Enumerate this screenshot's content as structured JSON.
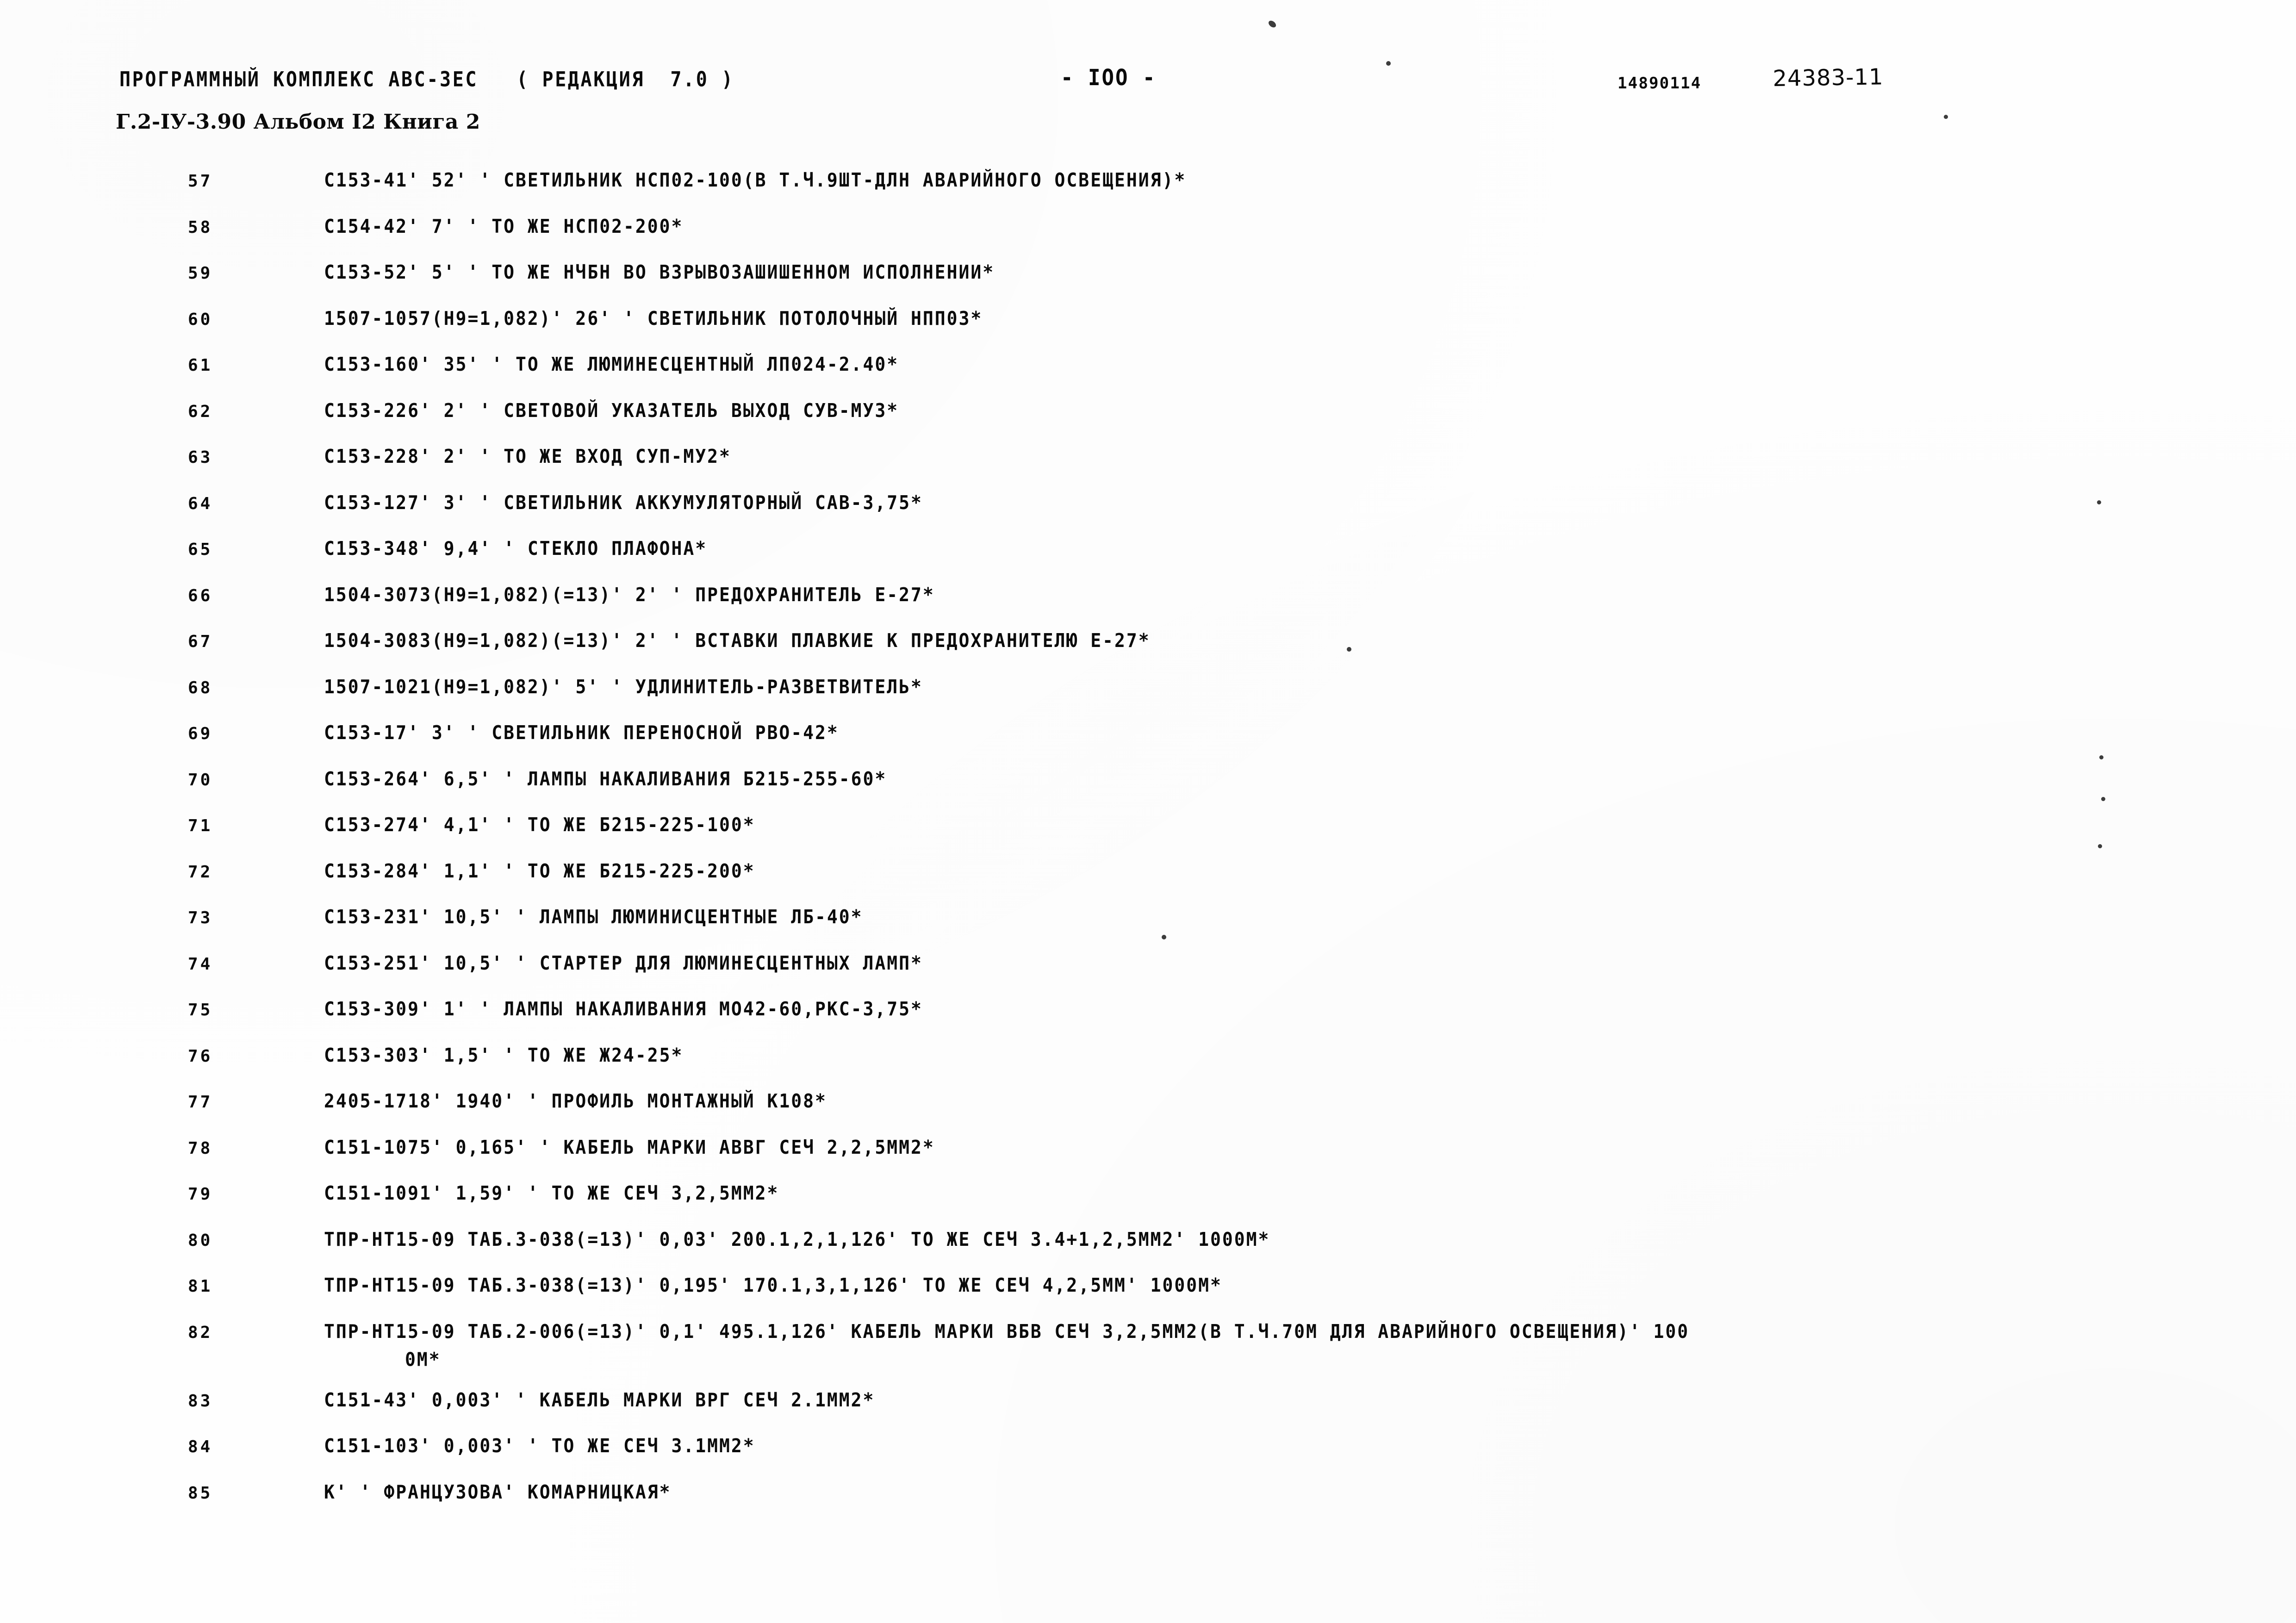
{
  "header": {
    "program_complex": "ПРОГРАММНЫЙ КОМПЛЕКС АВС-3ЕС   ( РЕДАКЦИЯ  7.0 )",
    "page_number": "- IOO -",
    "doc_code": "14890114",
    "stamp_number": "24383-11",
    "album_line": "Г.2-IУ-3.90 Альбом I2 Книга 2"
  },
  "listing": {
    "rows": [
      {
        "num": "57",
        "text": "C153-41' 52' ' СВЕТИЛЬНИК НСП02-100(В Т.Ч.9ШТ-ДЛН АВАРИЙНОГО ОСВЕЩЕНИЯ)*"
      },
      {
        "num": "58",
        "text": "C154-42' 7' ' ТО ЖЕ НСП02-200*"
      },
      {
        "num": "59",
        "text": "C153-52' 5' ' ТО ЖЕ НЧБН ВО ВЗРЫВОЗАШИШЕННОМ ИСПОЛНЕНИИ*"
      },
      {
        "num": "60",
        "text": "1507-1057(Н9=1,082)' 26' ' СВЕТИЛЬНИК ПОТОЛОЧНЫЙ НПП03*"
      },
      {
        "num": "61",
        "text": "C153-160' 35' ' ТО ЖЕ ЛЮМИНЕСЦЕНТНЫЙ ЛП024-2.40*"
      },
      {
        "num": "62",
        "text": "C153-226' 2' ' СВЕТОВОЙ УКАЗАТЕЛЬ ВЫХОД СУВ-МУ3*"
      },
      {
        "num": "63",
        "text": "C153-228' 2' ' ТО ЖЕ ВХОД СУП-МУ2*"
      },
      {
        "num": "64",
        "text": "C153-127' 3' ' СВЕТИЛЬНИК АККУМУЛЯТОРНЫЙ САВ-3,75*"
      },
      {
        "num": "65",
        "text": "C153-348' 9,4' ' СТЕКЛО ПЛАФОНА*"
      },
      {
        "num": "66",
        "text": "1504-3073(Н9=1,082)(=13)' 2' ' ПРЕДОХРАНИТЕЛЬ Е-27*"
      },
      {
        "num": "67",
        "text": "1504-3083(Н9=1,082)(=13)' 2' ' ВСТАВКИ ПЛАВКИЕ К ПРЕДОХРАНИТЕЛЮ Е-27*"
      },
      {
        "num": "68",
        "text": "1507-1021(Н9=1,082)' 5' ' УДЛИНИТЕЛЬ-РАЗВЕТВИТЕЛЬ*"
      },
      {
        "num": "69",
        "text": "C153-17' 3' ' СВЕТИЛЬНИК ПЕРЕНОСНОЙ РВО-42*"
      },
      {
        "num": "70",
        "text": "C153-264' 6,5' ' ЛАМПЫ НАКАЛИВАНИЯ Б215-255-60*"
      },
      {
        "num": "71",
        "text": "C153-274' 4,1' ' ТО ЖЕ Б215-225-100*"
      },
      {
        "num": "72",
        "text": "C153-284' 1,1' ' ТО ЖЕ Б215-225-200*"
      },
      {
        "num": "73",
        "text": "C153-231' 10,5' ' ЛАМПЫ ЛЮМИНИСЦЕНТНЫЕ ЛБ-40*"
      },
      {
        "num": "74",
        "text": "C153-251' 10,5' ' СТАРТЕР ДЛЯ ЛЮМИНЕСЦЕНТНЫХ ЛАМП*"
      },
      {
        "num": "75",
        "text": "C153-309' 1' ' ЛАМПЫ НАКАЛИВАНИЯ МО42-60,РКС-3,75*"
      },
      {
        "num": "76",
        "text": "C153-303' 1,5' ' ТО ЖЕ Ж24-25*"
      },
      {
        "num": "77",
        "text": "2405-1718' 1940' ' ПРОФИЛЬ МОНТАЖНЫЙ К108*"
      },
      {
        "num": "78",
        "text": "C151-1075' 0,165' ' КАБЕЛЬ МАРКИ АВВГ СЕЧ 2,2,5ММ2*"
      },
      {
        "num": "79",
        "text": "C151-1091' 1,59' ' ТО ЖЕ СЕЧ 3,2,5ММ2*"
      },
      {
        "num": "80",
        "text": "ТПР-НТ15-09 ТАБ.3-038(=13)' 0,03' 200.1,2,1,126' ТО ЖЕ СЕЧ 3.4+1,2,5ММ2' 1000М*"
      },
      {
        "num": "81",
        "text": "ТПР-НТ15-09 ТАБ.3-038(=13)' 0,195' 170.1,3,1,126' ТО ЖЕ СЕЧ 4,2,5ММ' 1000М*"
      },
      {
        "num": "82",
        "text": "ТПР-НТ15-09 ТАБ.2-006(=13)' 0,1' 495.1,126' КАБЕЛЬ МАРКИ ВБВ СЕЧ 3,2,5ММ2(В Т.Ч.70М ДЛЯ АВАРИЙНОГО ОСВЕЩЕНИЯ)' 100",
        "cont": "0М*"
      },
      {
        "num": "83",
        "text": "C151-43' 0,003' ' КАБЕЛЬ МАРКИ ВРГ СЕЧ 2.1ММ2*"
      },
      {
        "num": "84",
        "text": "C151-103' 0,003' ' ТО ЖЕ СЕЧ 3.1ММ2*"
      },
      {
        "num": "85",
        "text": "К' ' ФРАНЦУЗОВА' КОМАРНИЦКАЯ*"
      }
    ]
  },
  "colors": {
    "ink": "#0a0a0a",
    "paper": "#fefefe"
  }
}
